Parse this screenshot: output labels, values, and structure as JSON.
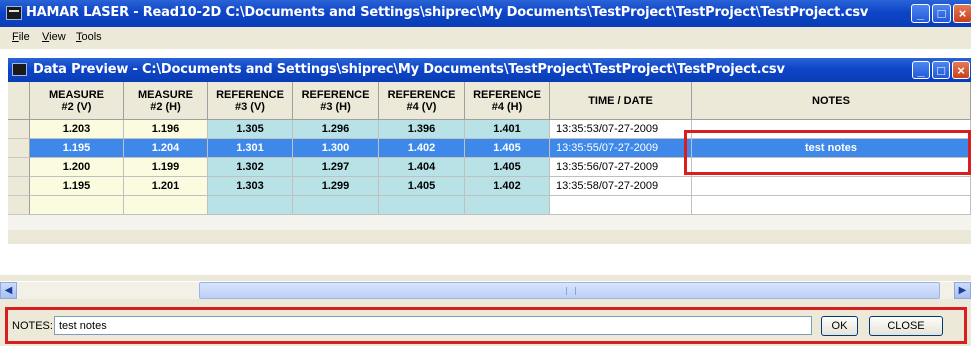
{
  "window": {
    "title": "HAMAR LASER - Read10-2D C:\\Documents and Settings\\shiprec\\My Documents\\TestProject\\TestProject\\TestProject.csv"
  },
  "menu": [
    {
      "label": "File",
      "accel": "F",
      "rest": "ile"
    },
    {
      "label": "View",
      "accel": "V",
      "rest": "iew"
    },
    {
      "label": "Tools",
      "accel": "T",
      "rest": "ools"
    }
  ],
  "child_window": {
    "title": "Data Preview - C:\\Documents and Settings\\shiprec\\My Documents\\TestProject\\TestProject\\TestProject.csv"
  },
  "table": {
    "columns": [
      {
        "line1": "MEASURE",
        "line2": "#2 (V)"
      },
      {
        "line1": "MEASURE",
        "line2": "#2 (H)"
      },
      {
        "line1": "REFERENCE",
        "line2": "#3 (V)"
      },
      {
        "line1": "REFERENCE",
        "line2": "#3 (H)"
      },
      {
        "line1": "REFERENCE",
        "line2": "#4 (V)"
      },
      {
        "line1": "REFERENCE",
        "line2": "#4 (H)"
      },
      {
        "line1": "TIME / DATE",
        "line2": ""
      },
      {
        "line1": "NOTES",
        "line2": ""
      }
    ],
    "rows": [
      [
        "1.203",
        "1.196",
        "1.305",
        "1.296",
        "1.396",
        "1.401",
        "13:35:53/07-27-2009",
        ""
      ],
      [
        "1.195",
        "1.204",
        "1.301",
        "1.300",
        "1.402",
        "1.405",
        "13:35:55/07-27-2009",
        "test notes"
      ],
      [
        "1.200",
        "1.199",
        "1.302",
        "1.297",
        "1.404",
        "1.405",
        "13:35:56/07-27-2009",
        ""
      ],
      [
        "1.195",
        "1.201",
        "1.303",
        "1.299",
        "1.405",
        "1.402",
        "13:35:58/07-27-2009",
        ""
      ],
      [
        "",
        "",
        "",
        "",
        "",
        "",
        "",
        ""
      ]
    ],
    "selected_row": 1,
    "colors": {
      "measure_bg": "#fbfbe0",
      "reference_bg": "#b8e2e6",
      "selected_bg": "#3d88e8",
      "highlight": "#d81e1e"
    }
  },
  "scrollbar": {
    "left_icon": "arrow-left-icon",
    "right_icon": "arrow-right-icon"
  },
  "notes_panel": {
    "label": "NOTES:",
    "value": "test notes",
    "ok_label": "OK",
    "close_label": "CLOSE"
  }
}
